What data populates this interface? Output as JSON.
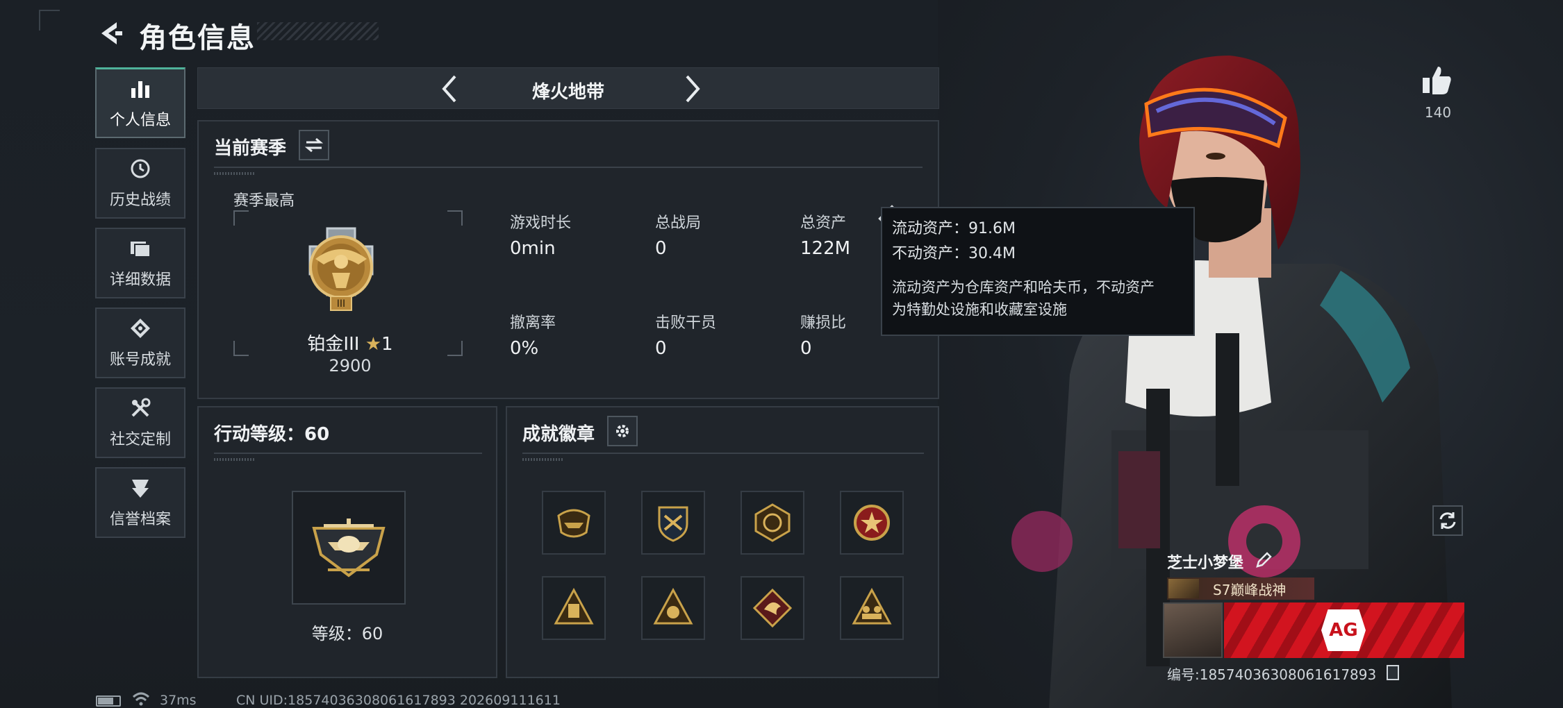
{
  "header": {
    "title": "角色信息"
  },
  "sidebar": {
    "items": [
      {
        "label": "个人信息",
        "icon": "bar-chart-icon",
        "active": true
      },
      {
        "label": "历史战绩",
        "icon": "history-icon"
      },
      {
        "label": "详细数据",
        "icon": "folder-icon"
      },
      {
        "label": "账号成就",
        "icon": "achievement-icon"
      },
      {
        "label": "社交定制",
        "icon": "tools-icon"
      },
      {
        "label": "信誉档案",
        "icon": "shield-icon"
      }
    ]
  },
  "mode_bar": {
    "name": "烽火地带"
  },
  "season": {
    "title": "当前赛季",
    "best_label": "赛季最高",
    "rank_name": "铂金III",
    "rank_stars": "1",
    "rank_score": "2900",
    "stats": [
      {
        "label": "游戏时长",
        "value": "0min"
      },
      {
        "label": "总战局",
        "value": "0"
      },
      {
        "label": "总资产",
        "value": "122M"
      },
      {
        "label": "撤离率",
        "value": "0%"
      },
      {
        "label": "击败干员",
        "value": "0"
      },
      {
        "label": "赚损比",
        "value": "0"
      }
    ]
  },
  "tooltip": {
    "liquid": "流动资产：91.6M",
    "fixed": "不动资产：30.4M",
    "desc_1": "流动资产为仓库资产和哈夫币，不动资产",
    "desc_2": "为特勤处设施和收藏室设施"
  },
  "action_level": {
    "title": "行动等级：60",
    "level_text": "等级：60"
  },
  "achievements": {
    "title": "成就徽章"
  },
  "likes": {
    "count": "140"
  },
  "player": {
    "name": "芝士小梦堡",
    "title_tag": "S7巅峰战神",
    "id_text": "编号:18574036308061617893"
  },
  "status_bar": {
    "ping": "37ms",
    "uid": "CN UID:18574036308061617893 202609111611"
  },
  "colors": {
    "accent": "#4fb39a",
    "gold": "#c9a24a",
    "red_banner": "#d2141f"
  }
}
